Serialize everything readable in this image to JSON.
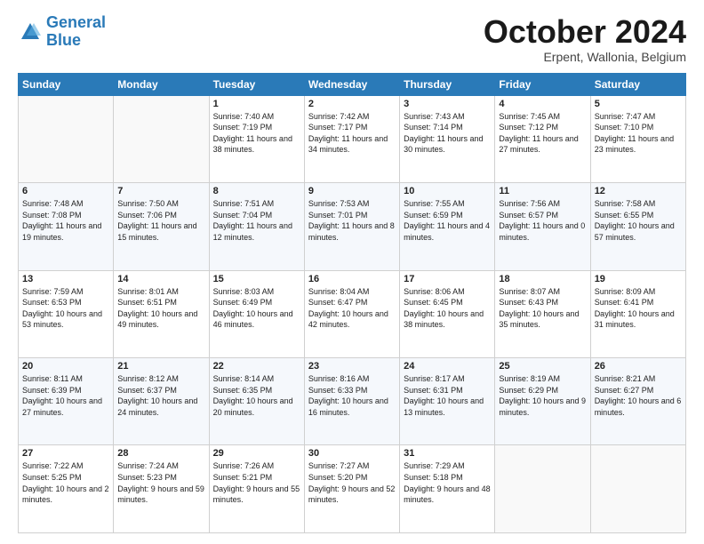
{
  "header": {
    "logo_line1": "General",
    "logo_line2": "Blue",
    "month_title": "October 2024",
    "location": "Erpent, Wallonia, Belgium"
  },
  "weekdays": [
    "Sunday",
    "Monday",
    "Tuesday",
    "Wednesday",
    "Thursday",
    "Friday",
    "Saturday"
  ],
  "weeks": [
    [
      {
        "day": "",
        "sunrise": "",
        "sunset": "",
        "daylight": ""
      },
      {
        "day": "",
        "sunrise": "",
        "sunset": "",
        "daylight": ""
      },
      {
        "day": "1",
        "sunrise": "Sunrise: 7:40 AM",
        "sunset": "Sunset: 7:19 PM",
        "daylight": "Daylight: 11 hours and 38 minutes."
      },
      {
        "day": "2",
        "sunrise": "Sunrise: 7:42 AM",
        "sunset": "Sunset: 7:17 PM",
        "daylight": "Daylight: 11 hours and 34 minutes."
      },
      {
        "day": "3",
        "sunrise": "Sunrise: 7:43 AM",
        "sunset": "Sunset: 7:14 PM",
        "daylight": "Daylight: 11 hours and 30 minutes."
      },
      {
        "day": "4",
        "sunrise": "Sunrise: 7:45 AM",
        "sunset": "Sunset: 7:12 PM",
        "daylight": "Daylight: 11 hours and 27 minutes."
      },
      {
        "day": "5",
        "sunrise": "Sunrise: 7:47 AM",
        "sunset": "Sunset: 7:10 PM",
        "daylight": "Daylight: 11 hours and 23 minutes."
      }
    ],
    [
      {
        "day": "6",
        "sunrise": "Sunrise: 7:48 AM",
        "sunset": "Sunset: 7:08 PM",
        "daylight": "Daylight: 11 hours and 19 minutes."
      },
      {
        "day": "7",
        "sunrise": "Sunrise: 7:50 AM",
        "sunset": "Sunset: 7:06 PM",
        "daylight": "Daylight: 11 hours and 15 minutes."
      },
      {
        "day": "8",
        "sunrise": "Sunrise: 7:51 AM",
        "sunset": "Sunset: 7:04 PM",
        "daylight": "Daylight: 11 hours and 12 minutes."
      },
      {
        "day": "9",
        "sunrise": "Sunrise: 7:53 AM",
        "sunset": "Sunset: 7:01 PM",
        "daylight": "Daylight: 11 hours and 8 minutes."
      },
      {
        "day": "10",
        "sunrise": "Sunrise: 7:55 AM",
        "sunset": "Sunset: 6:59 PM",
        "daylight": "Daylight: 11 hours and 4 minutes."
      },
      {
        "day": "11",
        "sunrise": "Sunrise: 7:56 AM",
        "sunset": "Sunset: 6:57 PM",
        "daylight": "Daylight: 11 hours and 0 minutes."
      },
      {
        "day": "12",
        "sunrise": "Sunrise: 7:58 AM",
        "sunset": "Sunset: 6:55 PM",
        "daylight": "Daylight: 10 hours and 57 minutes."
      }
    ],
    [
      {
        "day": "13",
        "sunrise": "Sunrise: 7:59 AM",
        "sunset": "Sunset: 6:53 PM",
        "daylight": "Daylight: 10 hours and 53 minutes."
      },
      {
        "day": "14",
        "sunrise": "Sunrise: 8:01 AM",
        "sunset": "Sunset: 6:51 PM",
        "daylight": "Daylight: 10 hours and 49 minutes."
      },
      {
        "day": "15",
        "sunrise": "Sunrise: 8:03 AM",
        "sunset": "Sunset: 6:49 PM",
        "daylight": "Daylight: 10 hours and 46 minutes."
      },
      {
        "day": "16",
        "sunrise": "Sunrise: 8:04 AM",
        "sunset": "Sunset: 6:47 PM",
        "daylight": "Daylight: 10 hours and 42 minutes."
      },
      {
        "day": "17",
        "sunrise": "Sunrise: 8:06 AM",
        "sunset": "Sunset: 6:45 PM",
        "daylight": "Daylight: 10 hours and 38 minutes."
      },
      {
        "day": "18",
        "sunrise": "Sunrise: 8:07 AM",
        "sunset": "Sunset: 6:43 PM",
        "daylight": "Daylight: 10 hours and 35 minutes."
      },
      {
        "day": "19",
        "sunrise": "Sunrise: 8:09 AM",
        "sunset": "Sunset: 6:41 PM",
        "daylight": "Daylight: 10 hours and 31 minutes."
      }
    ],
    [
      {
        "day": "20",
        "sunrise": "Sunrise: 8:11 AM",
        "sunset": "Sunset: 6:39 PM",
        "daylight": "Daylight: 10 hours and 27 minutes."
      },
      {
        "day": "21",
        "sunrise": "Sunrise: 8:12 AM",
        "sunset": "Sunset: 6:37 PM",
        "daylight": "Daylight: 10 hours and 24 minutes."
      },
      {
        "day": "22",
        "sunrise": "Sunrise: 8:14 AM",
        "sunset": "Sunset: 6:35 PM",
        "daylight": "Daylight: 10 hours and 20 minutes."
      },
      {
        "day": "23",
        "sunrise": "Sunrise: 8:16 AM",
        "sunset": "Sunset: 6:33 PM",
        "daylight": "Daylight: 10 hours and 16 minutes."
      },
      {
        "day": "24",
        "sunrise": "Sunrise: 8:17 AM",
        "sunset": "Sunset: 6:31 PM",
        "daylight": "Daylight: 10 hours and 13 minutes."
      },
      {
        "day": "25",
        "sunrise": "Sunrise: 8:19 AM",
        "sunset": "Sunset: 6:29 PM",
        "daylight": "Daylight: 10 hours and 9 minutes."
      },
      {
        "day": "26",
        "sunrise": "Sunrise: 8:21 AM",
        "sunset": "Sunset: 6:27 PM",
        "daylight": "Daylight: 10 hours and 6 minutes."
      }
    ],
    [
      {
        "day": "27",
        "sunrise": "Sunrise: 7:22 AM",
        "sunset": "Sunset: 5:25 PM",
        "daylight": "Daylight: 10 hours and 2 minutes."
      },
      {
        "day": "28",
        "sunrise": "Sunrise: 7:24 AM",
        "sunset": "Sunset: 5:23 PM",
        "daylight": "Daylight: 9 hours and 59 minutes."
      },
      {
        "day": "29",
        "sunrise": "Sunrise: 7:26 AM",
        "sunset": "Sunset: 5:21 PM",
        "daylight": "Daylight: 9 hours and 55 minutes."
      },
      {
        "day": "30",
        "sunrise": "Sunrise: 7:27 AM",
        "sunset": "Sunset: 5:20 PM",
        "daylight": "Daylight: 9 hours and 52 minutes."
      },
      {
        "day": "31",
        "sunrise": "Sunrise: 7:29 AM",
        "sunset": "Sunset: 5:18 PM",
        "daylight": "Daylight: 9 hours and 48 minutes."
      },
      {
        "day": "",
        "sunrise": "",
        "sunset": "",
        "daylight": ""
      },
      {
        "day": "",
        "sunrise": "",
        "sunset": "",
        "daylight": ""
      }
    ]
  ]
}
